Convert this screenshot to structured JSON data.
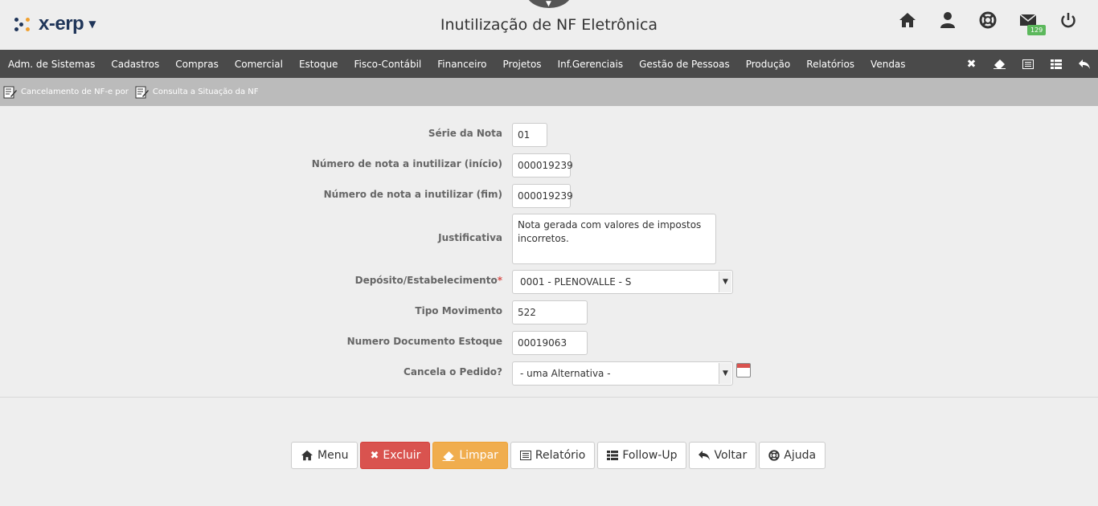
{
  "header": {
    "logo_text": "x-erp",
    "title": "Inutilização de NF Eletrônica",
    "icons": [
      "home-icon",
      "user-icon",
      "lifebuoy-icon",
      "envelope-icon",
      "power-icon"
    ],
    "mail_count": "129"
  },
  "menu": {
    "items": [
      "Adm. de Sistemas",
      "Cadastros",
      "Compras",
      "Comercial",
      "Estoque",
      "Fisco-Contábil",
      "Financeiro",
      "Projetos",
      "Inf.Gerenciais",
      "Gestão de Pessoas",
      "Produção",
      "Relatórios",
      "Vendas"
    ],
    "right_icons": [
      "close-icon",
      "eraser-icon",
      "report-icon",
      "table-icon",
      "back-icon"
    ]
  },
  "subbar": {
    "links": [
      "Cancelamento de NF-e por",
      "Consulta a Situação da NF"
    ]
  },
  "form": {
    "serie_label": "Série da Nota",
    "serie_value": "01",
    "inicio_label": "Número de nota a inutilizar (início)",
    "inicio_value": "000019239",
    "fim_label": "Número de nota a inutilizar (fim)",
    "fim_value": "000019239",
    "justificativa_label": "Justificativa",
    "justificativa_value": "Nota gerada com valores de impostos incorretos.",
    "deposito_label": "Depósito/Estabelecimento",
    "deposito_required": "*",
    "deposito_value": "0001 - PLENOVALLE - S",
    "tipo_label": "Tipo Movimento",
    "tipo_value": "522",
    "numdoc_label": "Numero Documento Estoque",
    "numdoc_value": "00019063",
    "cancela_label": "Cancela o Pedido?",
    "cancela_value": "- uma Alternativa -"
  },
  "buttons": {
    "menu": "Menu",
    "excluir": "Excluir",
    "limpar": "Limpar",
    "relatorio": "Relatório",
    "followup": "Follow-Up",
    "voltar": "Voltar",
    "ajuda": "Ajuda"
  },
  "colors": {
    "menubar": "#4a4a4a",
    "subbar": "#bbbbbb",
    "danger": "#d9534f",
    "warning": "#f0ad4e",
    "badge": "#5cb85c",
    "logo": "#1f3559"
  }
}
